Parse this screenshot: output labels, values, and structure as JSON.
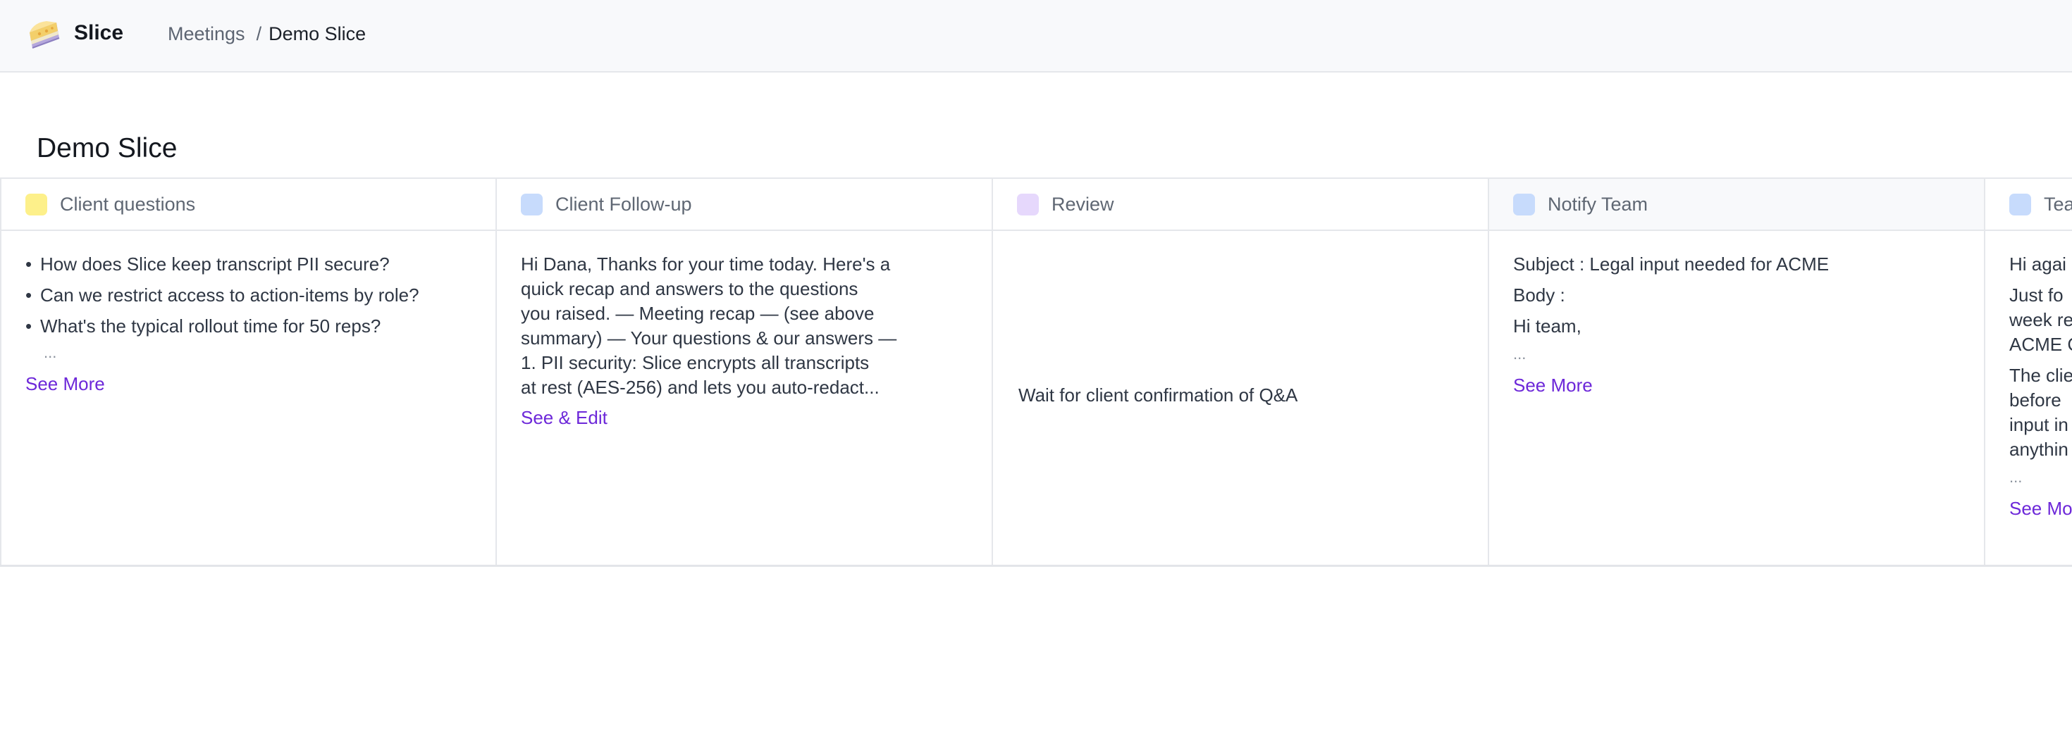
{
  "app": {
    "name": "Slice",
    "logo_icon": "cake-slice-icon"
  },
  "breadcrumb": {
    "parent": "Meetings",
    "separator": "/",
    "current": "Demo Slice"
  },
  "page": {
    "title": "Demo Slice"
  },
  "columns": [
    {
      "title": "Client questions",
      "color": "#fdf08a",
      "items": [
        "How does Slice keep transcript PII secure?",
        "Can we restrict access to action-items by role?",
        "What's the typical rollout time for 50 reps?"
      ],
      "ellipsis": "...",
      "link": "See More"
    },
    {
      "title": "Client Follow-up",
      "color": "#c7dbfc",
      "lines": [
        "Hi Dana, Thanks for your time today. Here's a",
        "quick recap and answers to the questions",
        "you raised. — Meeting recap — (see above",
        "summary) — Your questions & our answers —",
        "1. PII security: Slice encrypts all transcripts",
        "at rest (AES-256) and lets you auto-redact..."
      ],
      "link": "See & Edit"
    },
    {
      "title": "Review",
      "color": "#e6d8fc",
      "text": "Wait for client confirmation of Q&A"
    },
    {
      "title": "Notify Team",
      "color": "#c7dbfc",
      "lines": [
        "Subject : Legal input needed for ACME",
        "Body :",
        "Hi team,"
      ],
      "ellipsis": "...",
      "link": "See More"
    },
    {
      "title": "Tea",
      "color": "#c7dbfc",
      "para1": [
        "Hi agai"
      ],
      "para2": [
        "Just fo",
        "week re",
        "ACME C"
      ],
      "para3": [
        "The clie",
        "before",
        "input in",
        "anythin"
      ],
      "ellipsis": "...",
      "link": "See Mo"
    }
  ]
}
